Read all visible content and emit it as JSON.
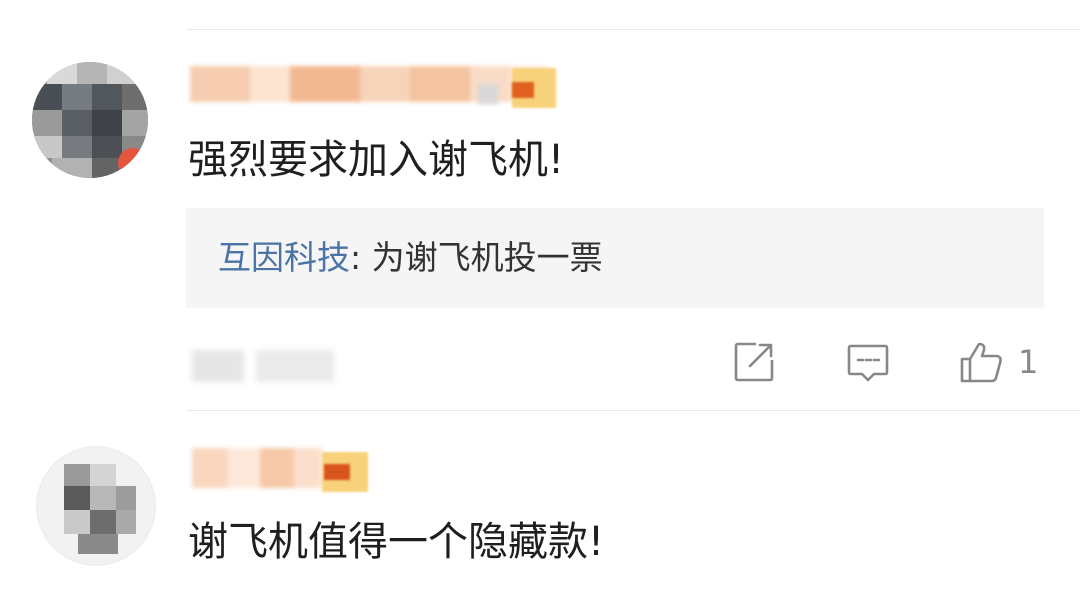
{
  "comments": [
    {
      "text": "强烈要求加入谢飞机!",
      "reply": {
        "author": "互因科技",
        "separator": ": ",
        "text": "为谢飞机投一票"
      },
      "actions": {
        "share_icon": "share-icon",
        "comment_icon": "comment-icon",
        "like_icon": "thumbs-up-icon",
        "like_count": "1"
      }
    },
    {
      "text": "谢飞机值得一个隐藏款!"
    }
  ],
  "colors": {
    "reply_author": "#4b74a6",
    "divider": "#e9e9e9",
    "reply_bg": "#f5f5f5",
    "icon": "#888888"
  }
}
